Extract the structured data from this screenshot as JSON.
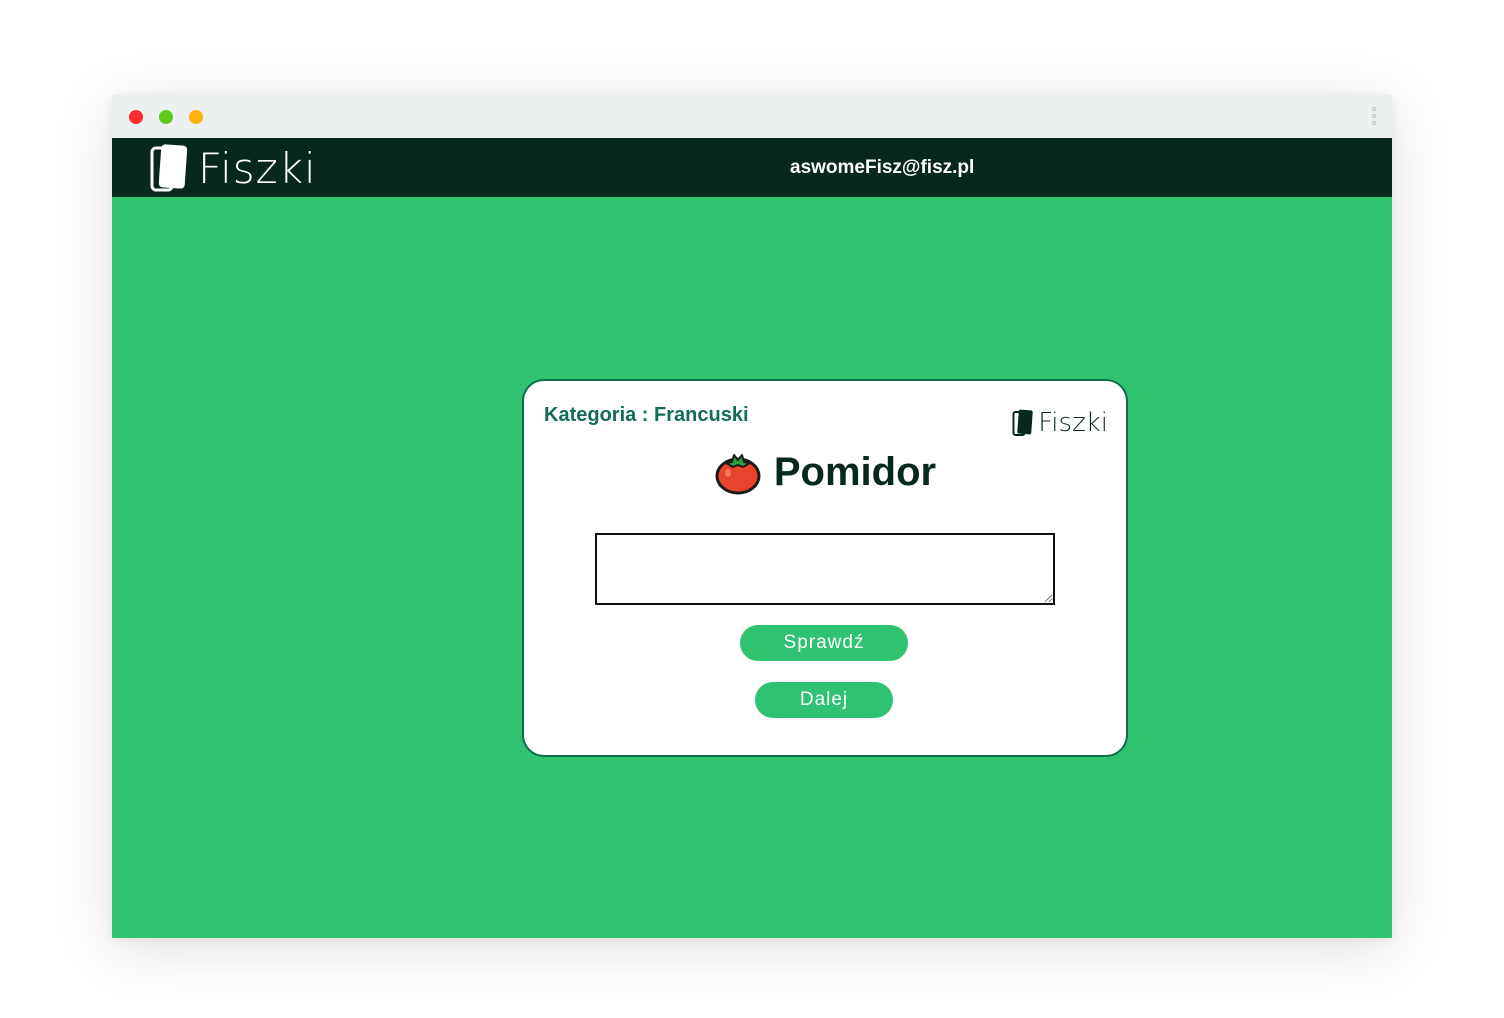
{
  "window": {
    "controls": [
      "close",
      "minimize",
      "maximize"
    ],
    "menu_icon": "kebab-menu-icon"
  },
  "navbar": {
    "brand": "Fiszki",
    "brand_icon": "flashcard-icon",
    "user_email": "aswomeFisz@fisz.pl"
  },
  "card": {
    "category": "Kategoria : Francuski",
    "logo_text": "Fiszki",
    "word": "Pomidor",
    "word_icon": "tomato-icon",
    "answer_value": "",
    "check_label": "Sprawdź",
    "next_label": "Dalej"
  },
  "colors": {
    "background_green": "#2fc271",
    "navbar_dark": "#07291c",
    "category_text": "#136b5a",
    "button_green": "#2fc271"
  }
}
